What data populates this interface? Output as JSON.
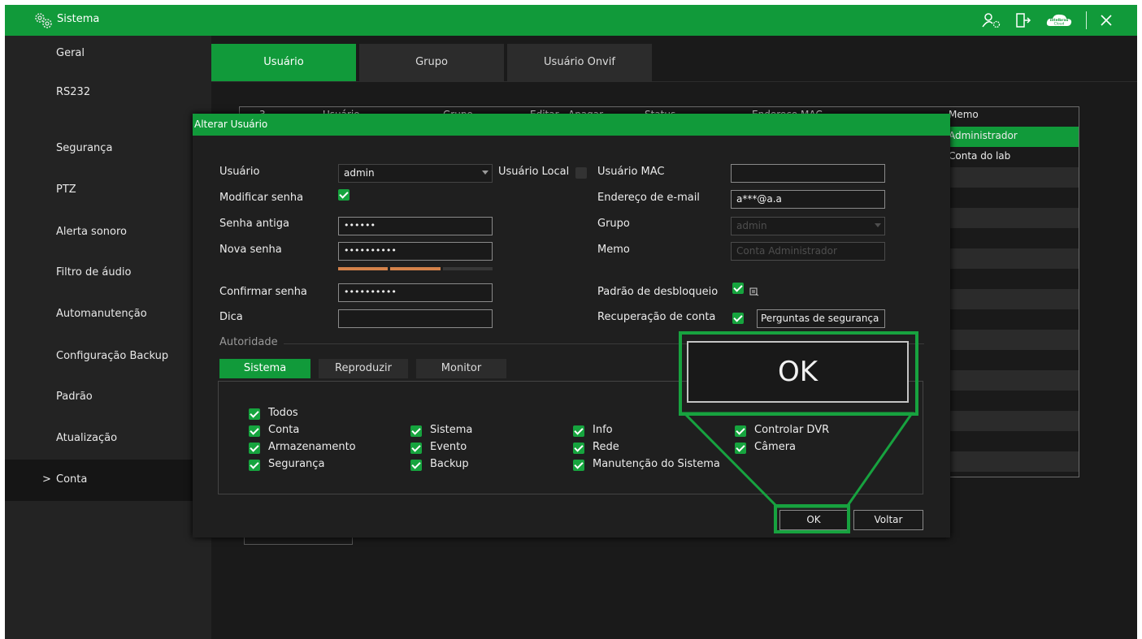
{
  "topbar": {
    "title": "Sistema",
    "icons": [
      "settings-gears-icon",
      "user-settings-icon",
      "logout-icon",
      "cloud-icon",
      "close-icon"
    ],
    "cloud_brand": "intelbras",
    "cloud_label": "Cloud",
    "accent": "#119a3a"
  },
  "sidebar": {
    "items": [
      {
        "label": "Geral"
      },
      {
        "label": "RS232"
      },
      {
        "label": "Segurança"
      },
      {
        "label": "PTZ"
      },
      {
        "label": "Alerta sonoro"
      },
      {
        "label": "Filtro de áudio"
      },
      {
        "label": "Automanutenção"
      },
      {
        "label": "Configuração Backup"
      },
      {
        "label": "Padrão"
      },
      {
        "label": "Atualização"
      },
      {
        "label": "Conta",
        "active": true
      }
    ],
    "active_marker": ">"
  },
  "tabs": [
    "Usuário",
    "Grupo",
    "Usuário Onvif"
  ],
  "user_table": {
    "columns": [
      "3",
      "Usuário",
      "Grupo",
      "Editar",
      "Apagar",
      "Status",
      "Endereço MAC",
      "Memo"
    ],
    "memo_values": [
      "Administrador",
      "Conta do lab"
    ]
  },
  "dialog": {
    "title": "Alterar Usuário",
    "usuario_label": "Usuário",
    "usuario_value": "admin",
    "usuario_local_label": "Usuário Local",
    "usuario_mac_label": "Usuário MAC",
    "usuario_mac_value": "",
    "modificar_senha_label": "Modificar senha",
    "email_label": "Endereço de e-mail",
    "email_value": "a***@a.a",
    "senha_antiga_label": "Senha antiga",
    "senha_antiga_value": "••••••",
    "grupo_label": "Grupo",
    "grupo_value": "admin",
    "nova_senha_label": "Nova senha",
    "nova_senha_value": "••••••••••",
    "memo_label": "Memo",
    "memo_placeholder": "Conta Administrador",
    "confirmar_senha_label": "Confirmar senha",
    "confirmar_senha_value": "••••••••••",
    "padrao_desbloqueio_label": "Padrão de desbloqueio",
    "dica_label": "Dica",
    "dica_value": "",
    "recuperacao_label": "Recuperação de conta",
    "recuperacao_value": "Perguntas de segurança",
    "autoridade_label": "Autoridade",
    "permission_tabs": [
      "Sistema",
      "Reproduzir",
      "Monitor"
    ],
    "permissions": {
      "todos": "Todos",
      "col1": [
        "Conta",
        "Armazenamento",
        "Segurança"
      ],
      "col2": [
        "Sistema",
        "Evento",
        "Backup"
      ],
      "col3": [
        "Info",
        "Rede",
        "Manutenção do Sistema"
      ],
      "col4": [
        "Controlar DVR",
        "Câmera"
      ]
    },
    "ok_label": "OK",
    "voltar_label": "Voltar"
  },
  "zoom_callout": {
    "label": "OK"
  }
}
